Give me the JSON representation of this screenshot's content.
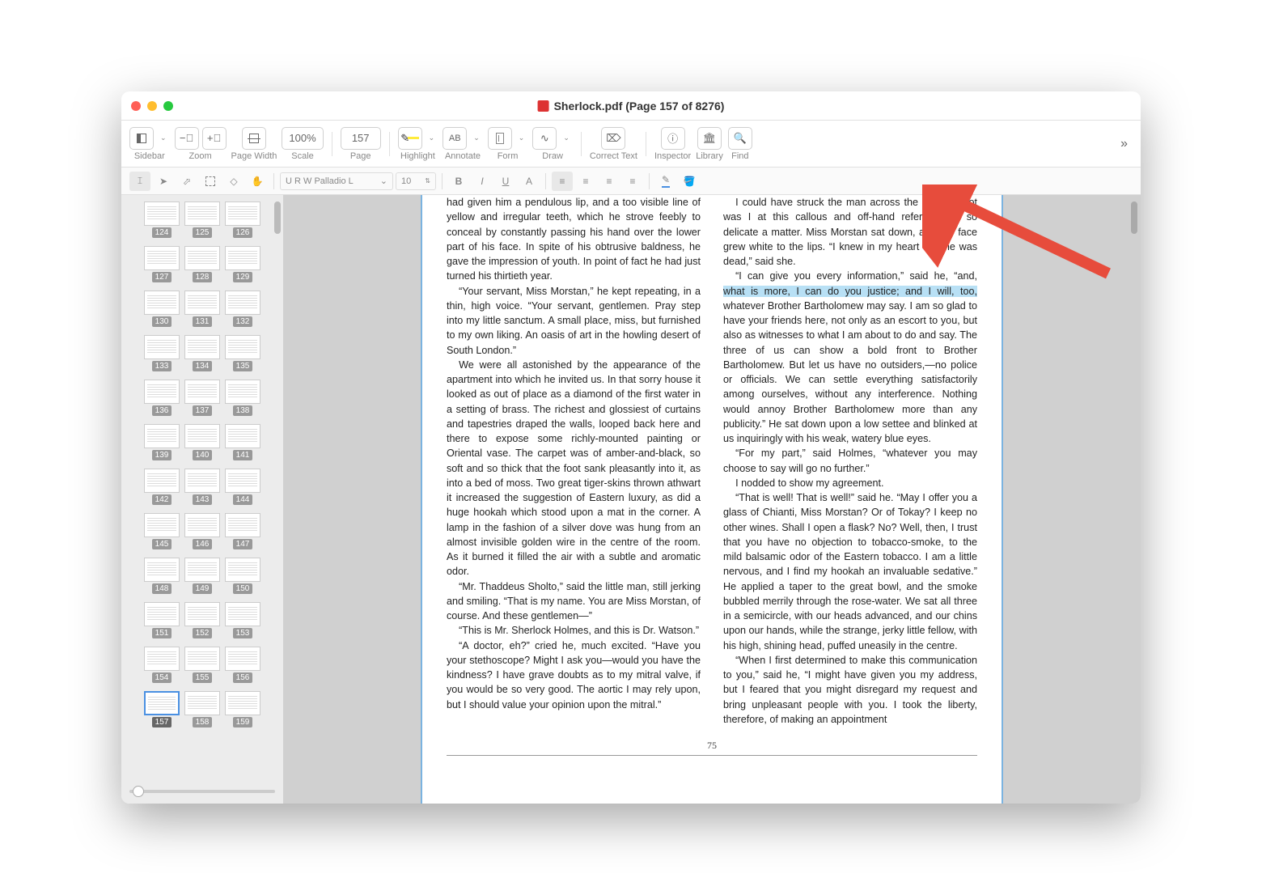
{
  "title": "Sherlock.pdf (Page 157 of 8276)",
  "toolbar": {
    "sidebar": "Sidebar",
    "zoom": "Zoom",
    "pagewidth": "Page Width",
    "scale": "Scale",
    "scale_val": "100%",
    "page": "Page",
    "page_val": "157",
    "highlight": "Highlight",
    "annotate": "Annotate",
    "form": "Form",
    "draw": "Draw",
    "correct": "Correct Text",
    "inspector": "Inspector",
    "library": "Library",
    "find": "Find"
  },
  "toolbar2": {
    "font": "U R W Palladio L",
    "size": "10"
  },
  "thumbs": [
    [
      124,
      125,
      126
    ],
    [
      127,
      128,
      129
    ],
    [
      130,
      131,
      132
    ],
    [
      133,
      134,
      135
    ],
    [
      136,
      137,
      138
    ],
    [
      139,
      140,
      141
    ],
    [
      142,
      143,
      144
    ],
    [
      145,
      146,
      147
    ],
    [
      148,
      149,
      150
    ],
    [
      151,
      152,
      153
    ],
    [
      154,
      155,
      156
    ],
    [
      157,
      158,
      159
    ]
  ],
  "current_thumb": 157,
  "page_number": "75",
  "col1": {
    "p1": "had given him a pendulous lip, and a too visible line of yellow and irregular teeth, which he strove feebly to conceal by constantly passing his hand over the lower part of his face. In spite of his obtrusive baldness, he gave the impression of youth. In point of fact he had just turned his thirtieth year.",
    "p2": "“Your servant, Miss Morstan,” he kept repeating, in a thin, high voice. “Your servant, gentlemen. Pray step into my little sanctum. A small place, miss, but furnished to my own liking. An oasis of art in the howling desert of South London.”",
    "p3": "We were all astonished by the appearance of the apartment into which he invited us. In that sorry house it looked as out of place as a diamond of the first water in a setting of brass. The richest and glossiest of curtains and tapestries draped the walls, looped back here and there to expose some richly-mounted painting or Oriental vase. The carpet was of amber-and-black, so soft and so thick that the foot sank pleasantly into it, as into a bed of moss. Two great tiger-skins thrown athwart it increased the suggestion of Eastern luxury, as did a huge hookah which stood upon a mat in the corner. A lamp in the fashion of a silver dove was hung from an almost invisible golden wire in the centre of the room. As it burned it filled the air with a subtle and aromatic odor.",
    "p4": "“Mr. Thaddeus Sholto,” said the little man, still jerking and smiling. “That is my name. You are Miss Morstan, of course. And these gentlemen—”",
    "p5": "“This is Mr. Sherlock Holmes, and this is Dr. Watson.”",
    "p6": "“A doctor, eh?” cried he, much excited. “Have you your stethoscope? Might I ask you—would you have the kindness? I have grave doubts as to my mitral valve, if you would be so very good. The aortic I may rely upon, but I should value your opinion upon the mitral.”"
  },
  "col2": {
    "p1": "I could have struck the man across the face, so hot was I at this callous and off-hand reference to so delicate a matter. Miss Morstan sat down, and her face grew white to the lips. “I knew in my heart that he was dead,” said she.",
    "p2a": "“I can give you every information,” said he, “and, ",
    "p2hl": "what is more, I can do you justice; and I will, too,",
    "p2b": " whatever Brother Bartholomew may say. I am so glad to have your friends here, not only as an escort to you, but also as witnesses to what I am about to do and say. The three of us can show a bold front to Brother Bartholomew. But let us have no outsiders,—no police or officials. We can settle everything satisfactorily among ourselves, without any interference. Nothing would annoy Brother Bartholomew more than any publicity.” He sat down upon a low settee and blinked at us inquiringly with his weak, watery blue eyes.",
    "p3": "“For my part,” said Holmes, “whatever you may choose to say will go no further.”",
    "p4": "I nodded to show my agreement.",
    "p5": "“That is well! That is well!” said he. “May I offer you a glass of Chianti, Miss Morstan? Or of Tokay? I keep no other wines. Shall I open a flask? No? Well, then, I trust that you have no objection to tobacco-smoke, to the mild balsamic odor of the Eastern tobacco. I am a little nervous, and I find my hookah an invaluable sedative.” He applied a taper to the great bowl, and the smoke bubbled merrily through the rose-water. We sat all three in a semicircle, with our heads advanced, and our chins upon our hands, while the strange, jerky little fellow, with his high, shining head, puffed uneasily in the centre.",
    "p6": "“When I first determined to make this communication to you,” said he, “I might have given you my address, but I feared that you might disregard my request and bring unpleasant people with you. I took the liberty, therefore, of making an appointment"
  }
}
